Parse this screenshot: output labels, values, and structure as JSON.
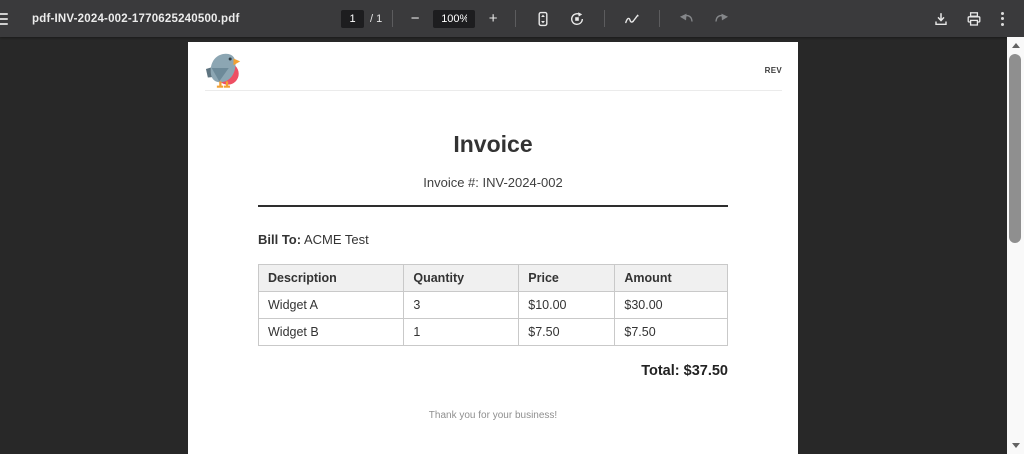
{
  "colors": {
    "toolbar_bg": "#3a3a3c",
    "viewer_bg": "#282828",
    "field_bg": "#1d1d1f",
    "table_header_bg": "#f0f0f0",
    "table_border": "#c9c9c9",
    "bird_body": "#8ca6b3",
    "bird_wing": "#6d8a99",
    "bird_belly": "#ee4f63",
    "bird_beak": "#f2a032"
  },
  "icons": {
    "zoom_out_glyph": "−",
    "zoom_in_glyph": "+"
  },
  "toolbar": {
    "filename": "pdf-INV-2024-002-1770625240500.pdf",
    "page_current": "1",
    "page_separator": "/",
    "page_total": "1",
    "zoom_level": "100%"
  },
  "invoice": {
    "rev_label": "REV",
    "title": "Invoice",
    "number_line": "Invoice #: INV-2024-002",
    "bill_to_label": "Bill To:",
    "bill_to_value": "ACME Test",
    "table": {
      "headers": [
        "Description",
        "Quantity",
        "Price",
        "Amount"
      ],
      "rows": [
        [
          "Widget A",
          "3",
          "$10.00",
          "$30.00"
        ],
        [
          "Widget B",
          "1",
          "$7.50",
          "$7.50"
        ]
      ]
    },
    "total_line": "Total: $37.50",
    "footer_note": "Thank you for your business!"
  }
}
